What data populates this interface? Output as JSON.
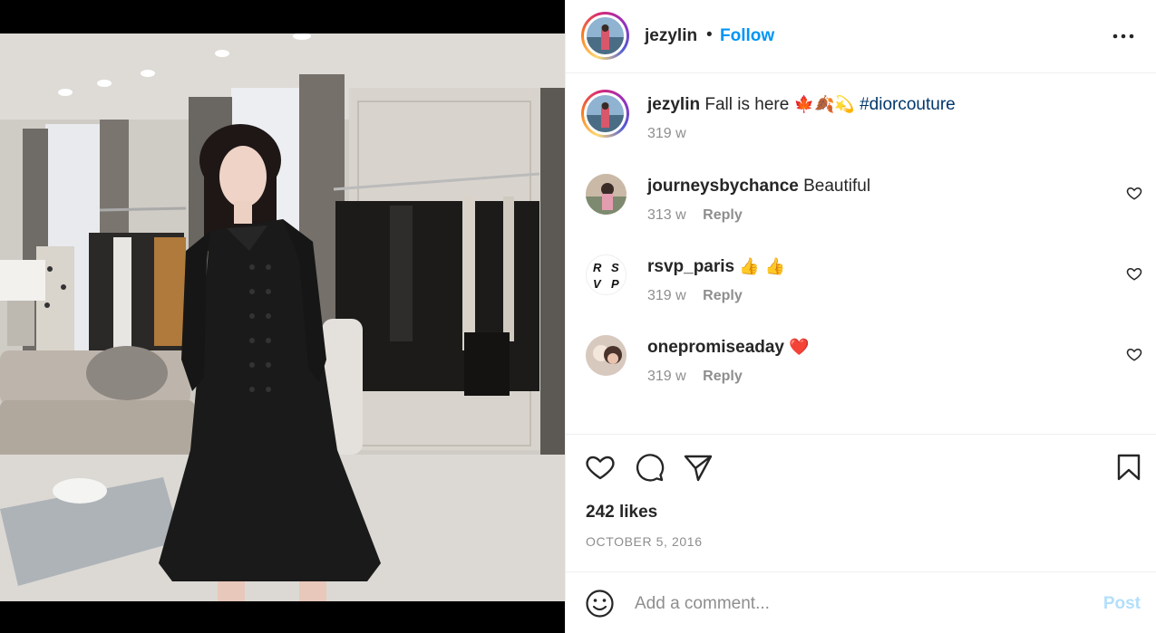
{
  "post": {
    "author": "jezylin",
    "separator": "•",
    "follow_label": "Follow",
    "caption_text": "Fall is here",
    "caption_emojis": "🍁🍂💫",
    "caption_hashtag": "#diorcouture",
    "caption_time": "319 w",
    "likes": "242 likes",
    "date": "OCTOBER 5, 2016"
  },
  "comments": [
    {
      "user": "journeysbychance",
      "text": "Beautiful",
      "emojis": "",
      "time": "313 w",
      "reply_label": "Reply"
    },
    {
      "user": "rsvp_paris",
      "text": "",
      "emojis": "👍 👍",
      "time": "319 w",
      "reply_label": "Reply",
      "avatar_text": [
        "R",
        "S",
        "V",
        "P"
      ]
    },
    {
      "user": "onepromiseaday",
      "text": "",
      "emojis": "❤️",
      "time": "319 w",
      "reply_label": "Reply"
    }
  ],
  "composer": {
    "placeholder": "Add a comment...",
    "post_label": "Post"
  },
  "icons": {
    "more": "more-options-icon",
    "like": "heart-icon",
    "comment": "comment-bubble-icon",
    "share": "paper-plane-icon",
    "save": "bookmark-icon",
    "emoji": "smiley-icon"
  },
  "colors": {
    "follow": "#0095f6",
    "hashtag": "#00376b",
    "meta": "#8e8e8e",
    "post_disabled": "#b2dffc"
  }
}
